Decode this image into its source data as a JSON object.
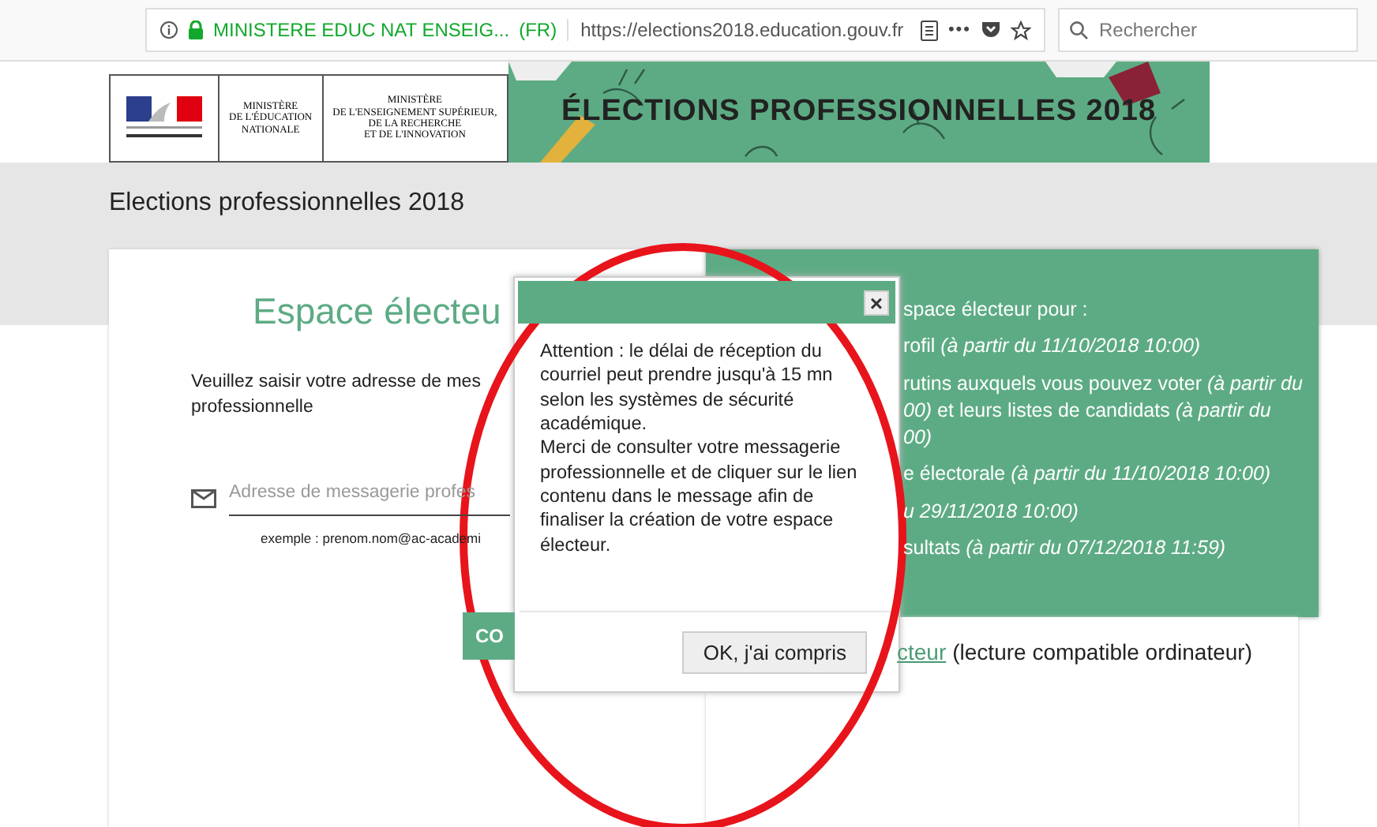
{
  "browser": {
    "site_name": "MINISTERE EDUC NAT ENSEIG...",
    "language": "(FR)",
    "url": "https://elections2018.education.gouv.fr",
    "menu_dots": "•••",
    "search": {
      "placeholder": "Rechercher"
    }
  },
  "header": {
    "ministries": [
      "MINISTÈRE\nDE L'ÉDUCATION\nNATIONALE",
      "MINISTÈRE\nDE L'ENSEIGNEMENT SUPÉRIEUR,\nDE LA RECHERCHE\nET DE L'INNOVATION"
    ],
    "banner_title": "ÉLECTIONS PROFESSIONNELLES 2018"
  },
  "page_title": "Elections professionnelles 2018",
  "login_card": {
    "title": "Espace électeu",
    "instruction": "Veuillez saisir votre adresse de mes",
    "instruction_line_2": "professionnelle",
    "email_field": {
      "placeholder": "Adresse de messagerie profes"
    },
    "example": "exemple : prenom.nom@ac-academi",
    "submit_button": "CO"
  },
  "info_panel": {
    "items": [
      {
        "lines": [
          "space électeur pour :"
        ]
      },
      {
        "lines": [
          "rofil *(à partir du 11/10/2018 10:00)*"
        ]
      },
      {
        "lines": [
          "rutins auxquels vous pouvez voter *(à partir du*",
          "*00)* et leurs listes de candidats *(à partir du*",
          "*00)*"
        ]
      },
      {
        "lines": [
          "e électorale *(à partir du 11/10/2018 10:00)*"
        ]
      },
      {
        "lines": [
          "*u 29/11/2018 10:00)*"
        ]
      },
      {
        "lines": [
          "sultats *(à partir du 07/12/2018 11:59)*"
        ]
      }
    ]
  },
  "guide": {
    "link": "cteur",
    "note": "(lecture compatible ordinateur)"
  },
  "modal": {
    "close": "×",
    "message": [
      "Attention : le délai de réception du courriel peut prendre jusqu'à 15 mn selon les systèmes de sécurité académique.",
      "Merci de consulter votre messagerie professionnelle et de cliquer sur le lien contenu dans le message afin de finaliser la création de votre espace électeur."
    ],
    "ok_button": "OK, j'ai compris"
  }
}
